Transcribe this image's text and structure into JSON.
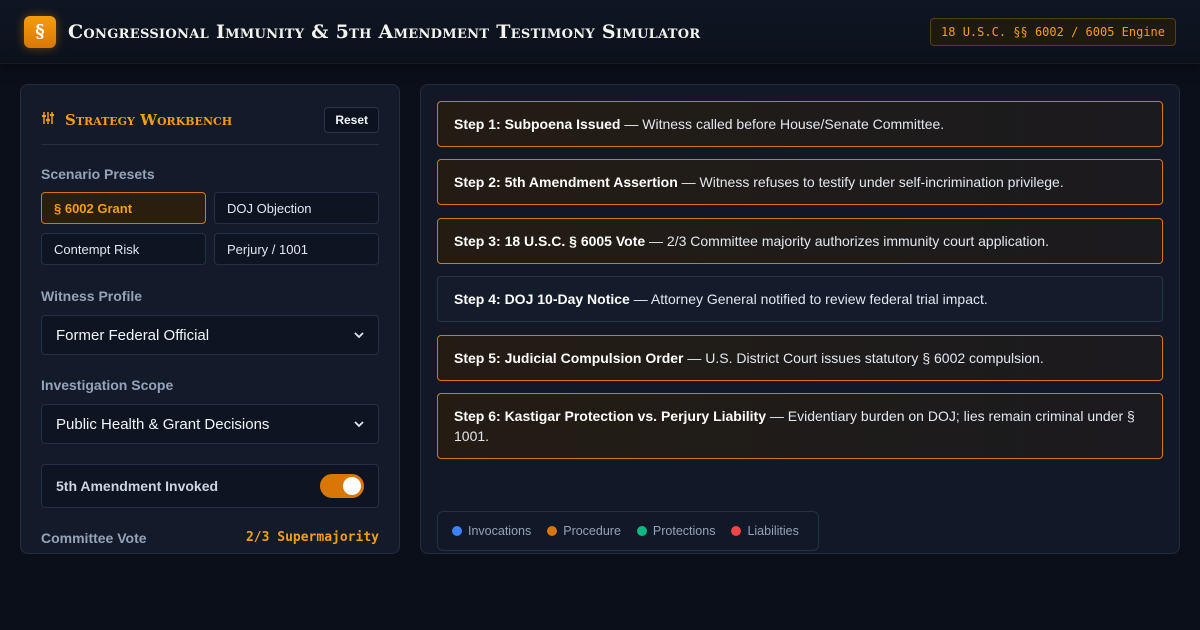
{
  "header": {
    "logo_glyph": "§",
    "title": "Congressional Immunity & 5th Amendment Testimony Simulator",
    "engine_badge": "18 U.S.C. §§ 6002 / 6005 Engine"
  },
  "workbench": {
    "title": "Strategy Workbench",
    "icon": "sliders-icon",
    "reset_label": "Reset",
    "presets_label": "Scenario Presets",
    "presets": [
      {
        "label": "§ 6002 Grant",
        "active": true
      },
      {
        "label": "DOJ Objection",
        "active": false
      },
      {
        "label": "Contempt Risk",
        "active": false
      },
      {
        "label": "Perjury / 1001",
        "active": false
      }
    ],
    "witness_label": "Witness Profile",
    "witness_value": "Former Federal Official",
    "scope_label": "Investigation Scope",
    "scope_value": "Public Health & Grant Decisions",
    "toggle_label": "5th Amendment Invoked",
    "toggle_on": true,
    "vote_label": "Committee Vote",
    "vote_value": "2/3 Supermajority"
  },
  "steps": [
    {
      "title": "Step 1: Subpoena Issued",
      "text": " — Witness called before House/Senate Committee.",
      "highlight": true
    },
    {
      "title": "Step 2: 5th Amendment Assertion",
      "text": " — Witness refuses to testify under self-incrimination privilege.",
      "highlight": true
    },
    {
      "title": "Step 3: 18 U.S.C. § 6005 Vote",
      "text": " — 2/3 Committee majority authorizes immunity court application.",
      "highlight": true
    },
    {
      "title": "Step 4: DOJ 10-Day Notice",
      "text": " — Attorney General notified to review federal trial impact.",
      "highlight": false
    },
    {
      "title": "Step 5: Judicial Compulsion Order",
      "text": " — U.S. District Court issues statutory § 6002 compulsion.",
      "highlight": true
    },
    {
      "title": "Step 6: Kastigar Protection vs. Perjury Liability",
      "text": " — Evidentiary burden on DOJ; lies remain criminal under § 1001.",
      "highlight": true
    }
  ],
  "legend": [
    {
      "label": "Invocations",
      "color": "#3b82f6"
    },
    {
      "label": "Procedure",
      "color": "#d97706"
    },
    {
      "label": "Protections",
      "color": "#10b981"
    },
    {
      "label": "Liabilities",
      "color": "#ef4444"
    }
  ]
}
